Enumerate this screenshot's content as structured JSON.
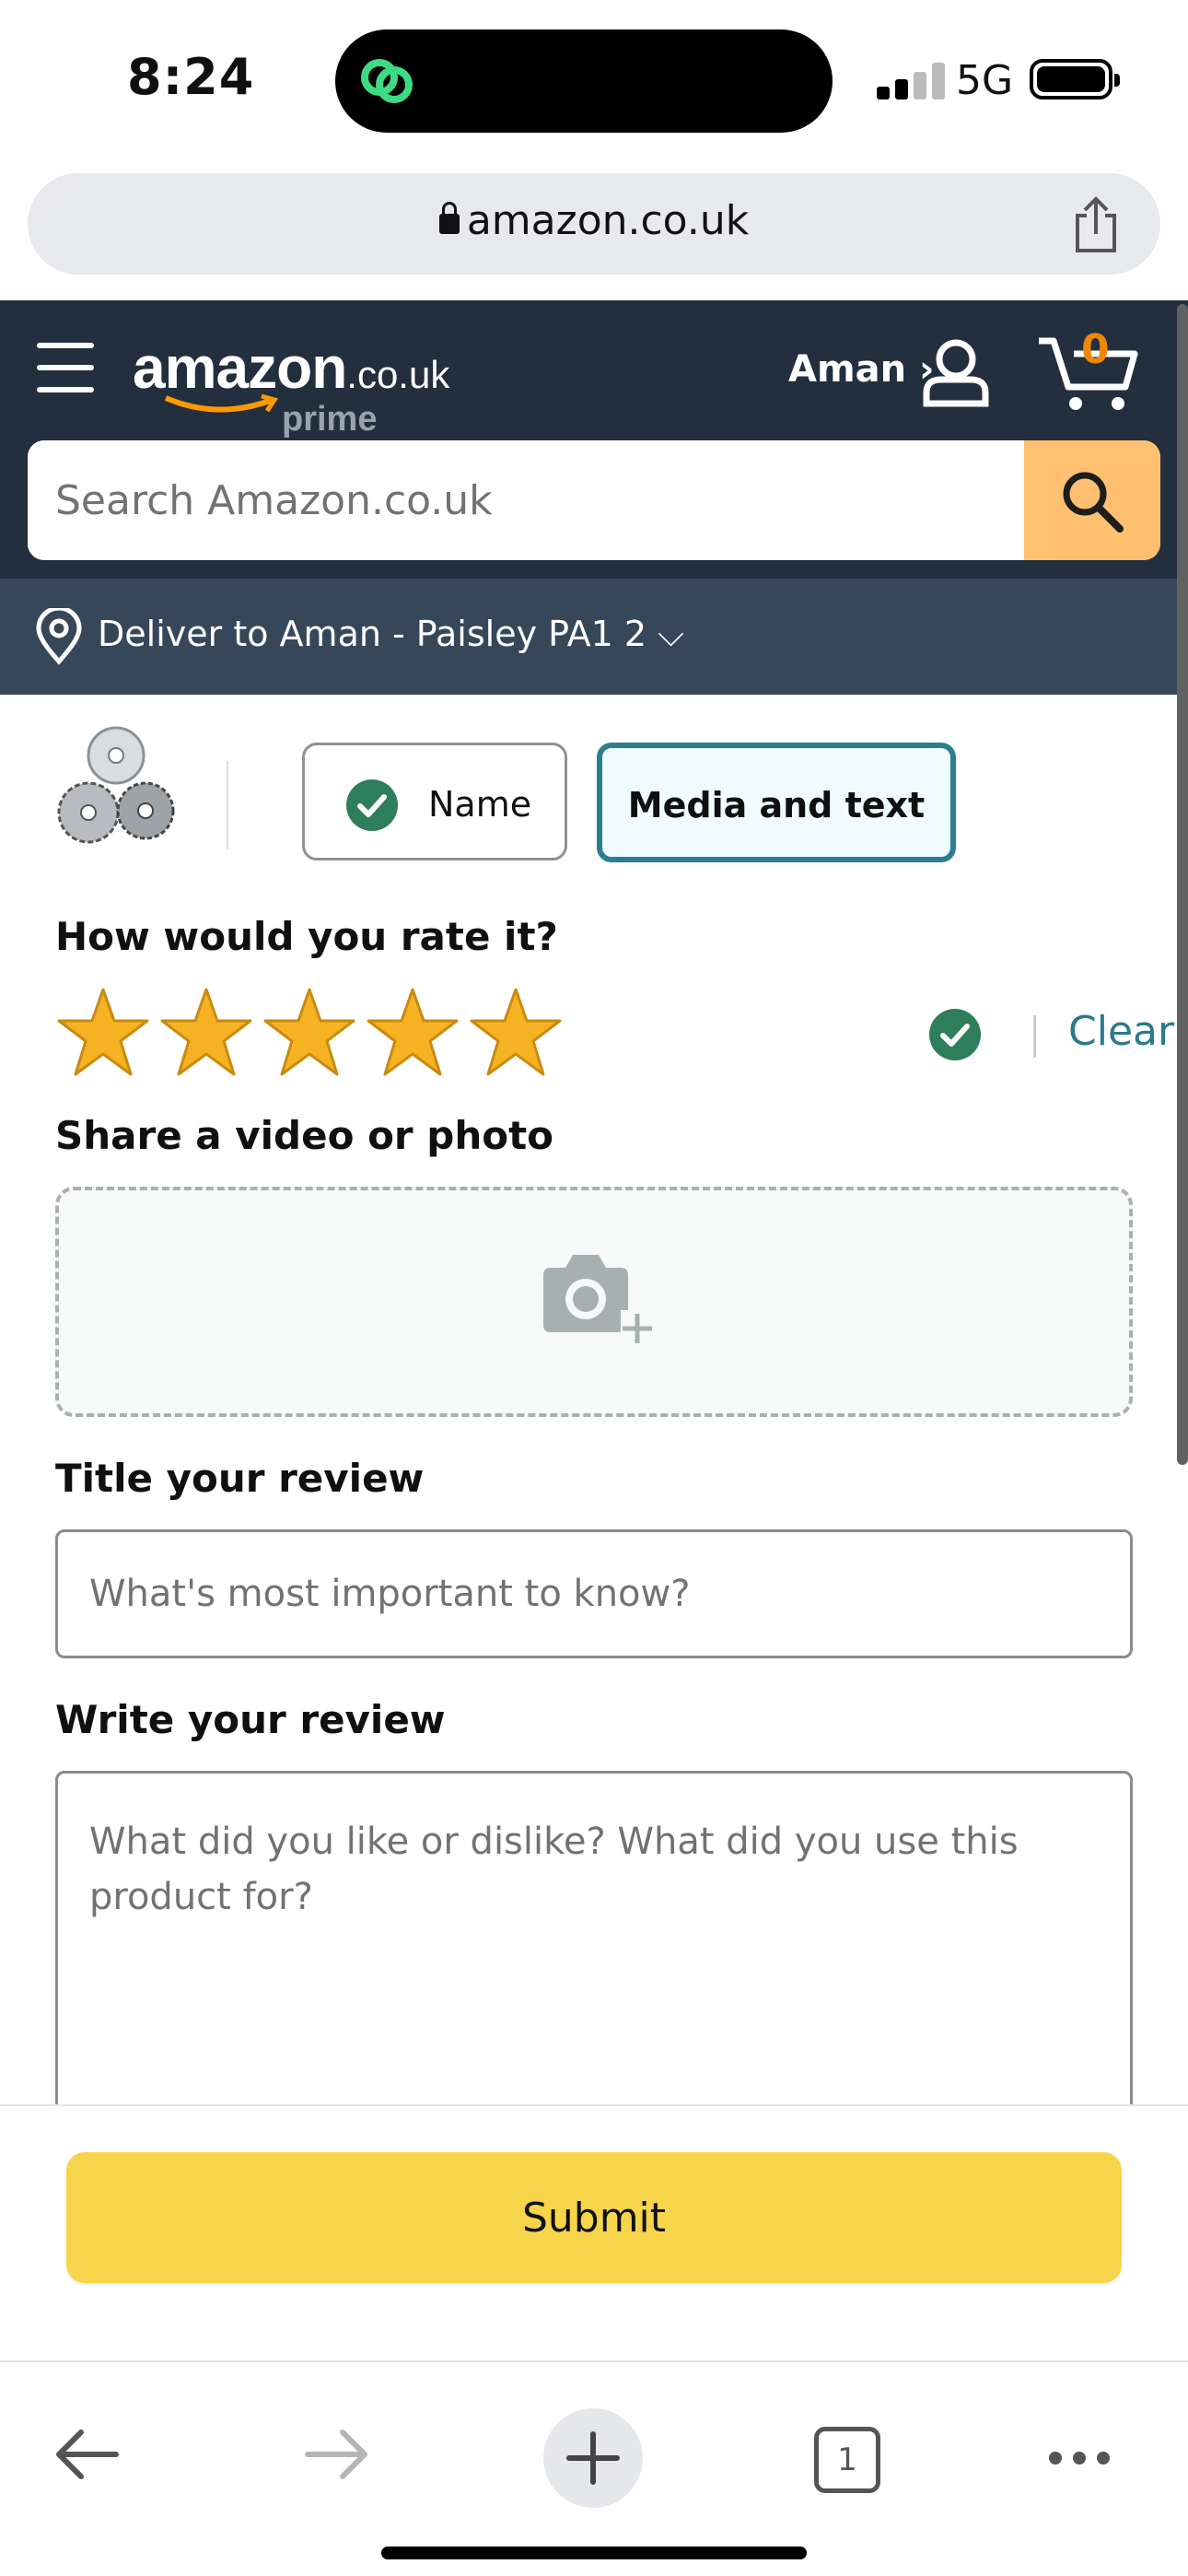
{
  "status_bar": {
    "time": "8:24",
    "network": "5G"
  },
  "browser": {
    "url": "amazon.co.uk"
  },
  "header": {
    "logo_main": "amazon",
    "logo_tld": ".co.uk",
    "logo_prime": "prime",
    "account_label": "Aman ›",
    "cart_count": "0",
    "search_placeholder": "Search Amazon.co.uk",
    "deliver_to": "Deliver to Aman - Paisley PA1 2 ⌵"
  },
  "review_form": {
    "tabs": [
      {
        "label": "Name",
        "state": "completed"
      },
      {
        "label": "Media and text",
        "state": "active"
      }
    ],
    "rating_heading": "How would you rate it?",
    "rating_value": 5,
    "rating_max": 5,
    "clear_label": "Clear",
    "media_heading": "Share a video or photo",
    "title_heading": "Title your review",
    "title_placeholder": "What's most important to know?",
    "review_heading": "Write your review",
    "review_placeholder": "What did you like or dislike? What did you use this product for?",
    "submit_label": "Submit"
  },
  "toolbar": {
    "tab_count": "1"
  },
  "colors": {
    "header_bg": "#232f3e",
    "deliver_bg": "#37475a",
    "search_button": "#febd69",
    "submit_button": "#f7d54b",
    "active_tab_border": "#2b7e8f",
    "link": "#2a7a8c",
    "check_green": "#2e7d5b",
    "star_fill": "#f5b323"
  },
  "icons": [
    "lock-icon",
    "share-icon",
    "hamburger-icon",
    "account-icon",
    "cart-icon",
    "search-icon",
    "location-pin-icon",
    "check-icon",
    "star-icon",
    "camera-add-icon",
    "back-arrow-icon",
    "forward-arrow-icon",
    "plus-icon",
    "tabs-icon",
    "more-icon"
  ]
}
